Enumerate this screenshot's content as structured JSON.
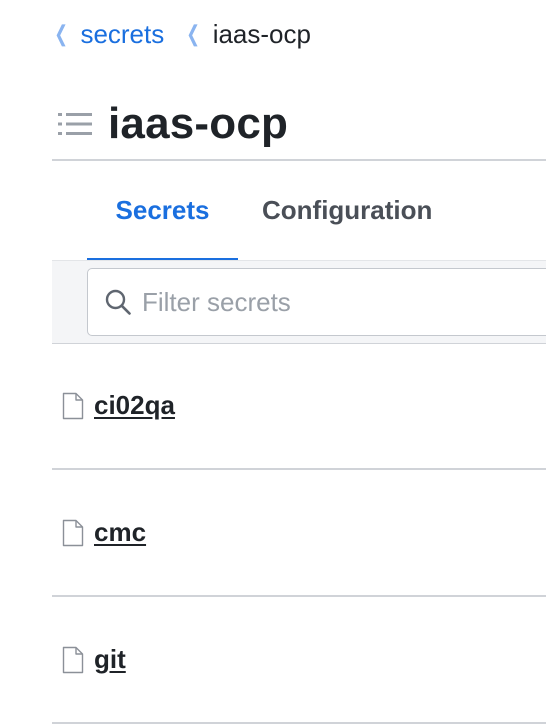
{
  "breadcrumb": {
    "items": [
      {
        "label": "secrets",
        "link": true
      },
      {
        "label": "iaas-ocp",
        "link": false
      }
    ],
    "chevron_icon": "chevron-left-icon",
    "link_color": "#1a6fdf"
  },
  "header": {
    "title": "iaas-ocp",
    "icon": "list-icon"
  },
  "tabs": [
    {
      "label": "Secrets",
      "active": true
    },
    {
      "label": "Configuration",
      "active": false
    }
  ],
  "filter": {
    "placeholder": "Filter secrets",
    "value": "",
    "icon": "search-icon"
  },
  "secrets": [
    {
      "name": "ci02qa",
      "icon": "file-icon"
    },
    {
      "name": "cmc",
      "icon": "file-icon"
    },
    {
      "name": "git",
      "icon": "file-icon"
    }
  ],
  "colors": {
    "accent": "#1a6fdf",
    "divider": "#d0d3d8",
    "filter_bg": "#f4f5f7"
  }
}
